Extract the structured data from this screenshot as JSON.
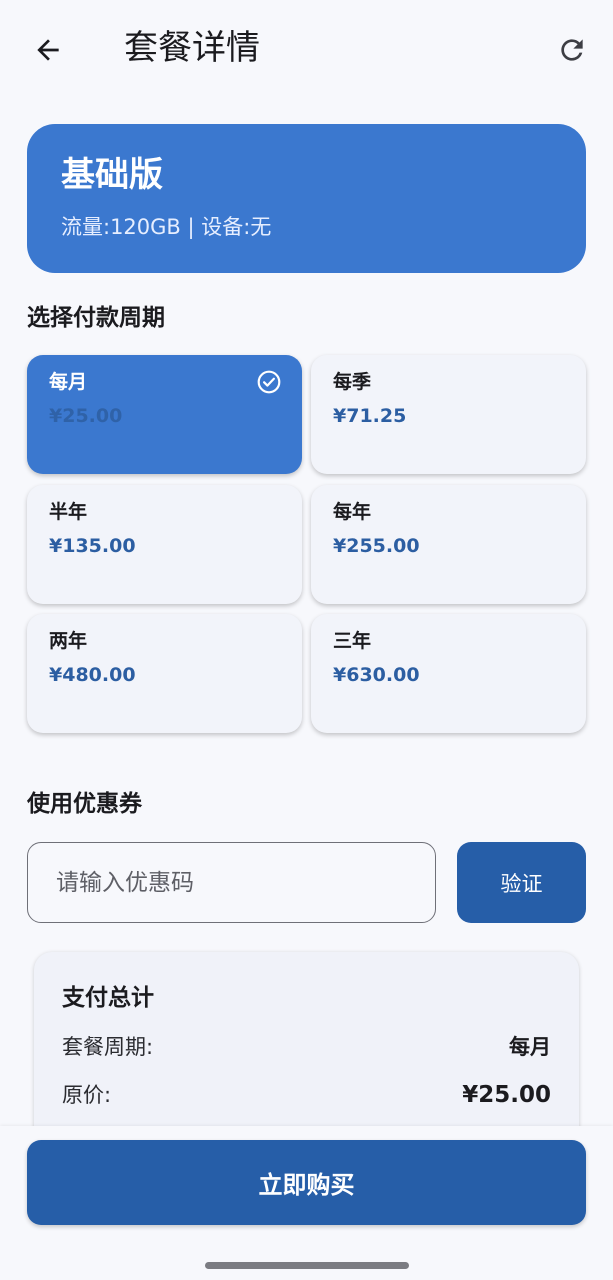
{
  "header": {
    "title": "套餐详情",
    "back_icon": "arrow-left-icon",
    "refresh_icon": "refresh-icon"
  },
  "plan": {
    "name": "基础版",
    "meta": "流量:120GB | 设备:无"
  },
  "period_section": {
    "title": "选择付款周期",
    "options": [
      {
        "label": "每月",
        "price": "¥25.00",
        "selected": true
      },
      {
        "label": "每季",
        "price": "¥71.25",
        "selected": false
      },
      {
        "label": "半年",
        "price": "¥135.00",
        "selected": false
      },
      {
        "label": "每年",
        "price": "¥255.00",
        "selected": false
      },
      {
        "label": "两年",
        "price": "¥480.00",
        "selected": false
      },
      {
        "label": "三年",
        "price": "¥630.00",
        "selected": false
      }
    ]
  },
  "coupon": {
    "title": "使用优惠券",
    "placeholder": "请输入优惠码",
    "value": "",
    "verify_label": "验证"
  },
  "summary": {
    "title": "支付总计",
    "rows": [
      {
        "label": "套餐周期:",
        "value": "每月"
      },
      {
        "label": "原价:",
        "value": "¥25.00"
      }
    ]
  },
  "footer": {
    "buy_label": "立即购买"
  },
  "colors": {
    "primary": "#3b78cf",
    "button": "#265ea8",
    "price": "#2c5ea2",
    "background": "#f7f8fc"
  }
}
